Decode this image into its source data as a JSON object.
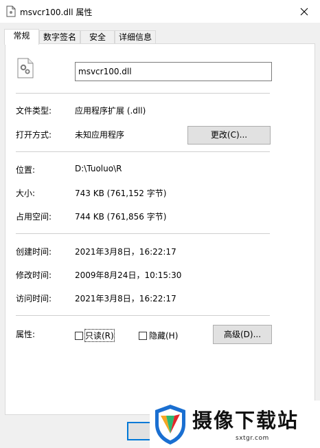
{
  "window": {
    "title": "msvcr100.dll 属性"
  },
  "tabs": [
    {
      "label": "常规"
    },
    {
      "label": "数字签名"
    },
    {
      "label": "安全"
    },
    {
      "label": "详细信息"
    }
  ],
  "general": {
    "file_name": "msvcr100.dll",
    "file_type": {
      "label": "文件类型:",
      "value": "应用程序扩展 (.dll)"
    },
    "opens_with": {
      "label": "打开方式:",
      "value": "未知应用程序",
      "button": "更改(C)..."
    },
    "location": {
      "label": "位置:",
      "value": "D:\\Tuoluo\\R"
    },
    "size": {
      "label": "大小:",
      "value": "743 KB (761,152 字节)"
    },
    "size_on_disk": {
      "label": "占用空间:",
      "value": "744 KB (761,856 字节)"
    },
    "created": {
      "label": "创建时间:",
      "value": "2021年3月8日，16:22:17"
    },
    "modified": {
      "label": "修改时间:",
      "value": "2009年8月24日，10:15:30"
    },
    "accessed": {
      "label": "访问时间:",
      "value": "2021年3月8日，16:22:17"
    },
    "attributes": {
      "label": "属性:",
      "readonly": {
        "label": "只读(R)",
        "checked": false
      },
      "hidden": {
        "label": "隐藏(H)",
        "checked": false
      },
      "advanced_button": "高级(D)..."
    }
  },
  "watermark": {
    "text": "摄像下载站",
    "url": "sxtgr.com"
  },
  "icons": [
    "document-icon",
    "close-icon",
    "dll-file-icon",
    "watermark-logo-icon"
  ]
}
